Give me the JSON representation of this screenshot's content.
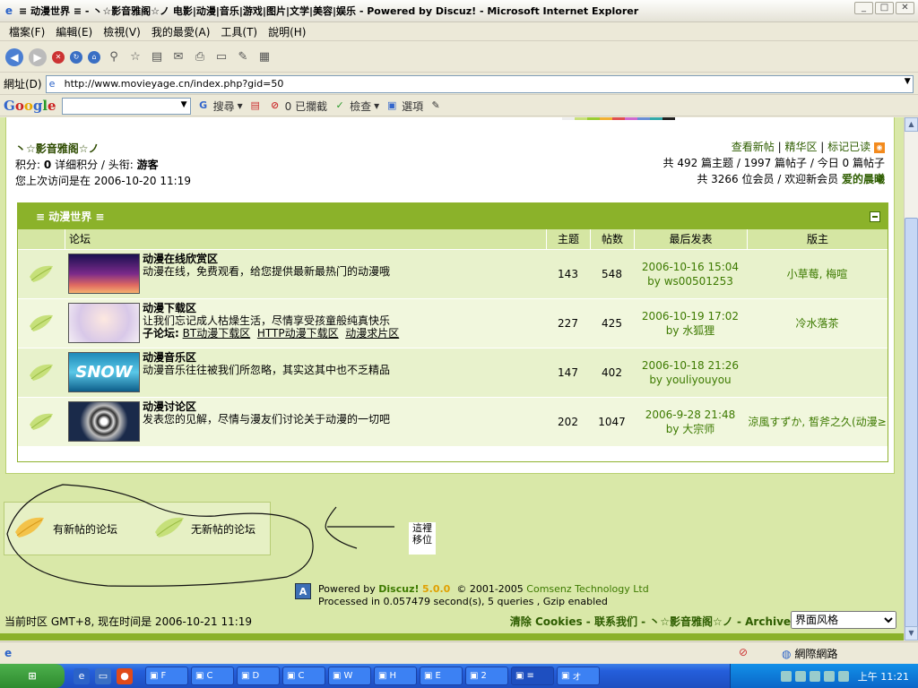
{
  "window": {
    "title": "≡ 动漫世界 ≡ - 丶☆影音雅阁☆ノ 电影|动漫|音乐|游戏|图片|文学|美容|娱乐 - Powered by Discuz! - Microsoft Internet Explorer"
  },
  "menu": [
    "檔案(F)",
    "編輯(E)",
    "檢視(V)",
    "我的最愛(A)",
    "工具(T)",
    "說明(H)"
  ],
  "address": {
    "label": "網址(D)",
    "url": "http://www.movieyage.cn/index.php?gid=50"
  },
  "google": {
    "logo": "Google",
    "search_label": "搜尋",
    "blocked_label": "0 已攔截",
    "check_label": "檢查",
    "options_label": "選項"
  },
  "header": {
    "site_name": "丶☆影音雅阁☆ノ",
    "points_label": "积分:",
    "points_value": "0",
    "points_detail": "详细积分 / 头衔:",
    "rank": "游客",
    "last_visit": "您上次访问是在 2006-10-20 11:19",
    "links": [
      "查看新帖",
      "精华区",
      "标记已读"
    ],
    "stats": "共 492 篇主题 / 1997 篇帖子 / 今日 0 篇帖子",
    "members_prefix": "共 3266 位会员 / 欢迎新会员",
    "newest_member": "爱的晨曦"
  },
  "forum_group": {
    "title": "≡ 动漫世界 ≡",
    "columns": {
      "forum": "论坛",
      "topics": "主题",
      "posts": "帖数",
      "last_post": "最后发表",
      "moderators": "版主"
    },
    "forums": [
      {
        "name": "动漫在线欣赏区",
        "desc": "动漫在线，免费观看，给您提供最新最热门的动漫哦",
        "sub_label": "",
        "subforums": [],
        "topics": "143",
        "posts": "548",
        "last_date": "2006-10-16 15:04",
        "last_by": "by ws00501253",
        "moderators": "小草莓, 梅喧"
      },
      {
        "name": "动漫下载区",
        "desc": "让我们忘记成人枯燥生活，尽情享受孩童般纯真快乐",
        "sub_label": "子论坛:",
        "subforums": [
          "BT动漫下载区",
          "HTTP动漫下载区",
          "动漫求片区"
        ],
        "topics": "227",
        "posts": "425",
        "last_date": "2006-10-19 17:02",
        "last_by": "by 水狐狸",
        "moderators": "冷水落茶"
      },
      {
        "name": "动漫音乐区",
        "desc": "动漫音乐往往被我们所忽略，其实这其中也不乏精品",
        "sub_label": "",
        "subforums": [],
        "topics": "147",
        "posts": "402",
        "last_date": "2006-10-18 21:26",
        "last_by": "by youliyouyou",
        "moderators": ""
      },
      {
        "name": "动漫讨论区",
        "desc": "发表您的见解，尽情与漫友们讨论关于动漫的一切吧",
        "sub_label": "",
        "subforums": [],
        "topics": "202",
        "posts": "1047",
        "last_date": "2006-9-28 21:48",
        "last_by": "by 大宗师",
        "moderators": "涼風すずか, 皙斧之久(动漫≥"
      }
    ]
  },
  "legend": {
    "new_posts": "有新帖的论坛",
    "no_new_posts": "无新帖的论坛"
  },
  "annotation": "這裡移位",
  "footer": {
    "powered_prefix": "Powered by",
    "product": "Discuz!",
    "version": "5.0.0",
    "copyright_years": "© 2001-2005",
    "company": "Comsenz Technology Ltd",
    "processed": "Processed in 0.057479 second(s), 5 queries , Gzip enabled"
  },
  "bottom": {
    "timezone": "当前时区 GMT+8, 现在时间是 2006-10-21 11:19",
    "links": "清除 Cookies - 联系我们 - 丶☆影音雅阁☆ノ - Archiver",
    "style_select": "界面风格"
  },
  "status": {
    "zone": "網際網路"
  },
  "taskbar": {
    "tasks": [
      "F",
      "C",
      "D",
      "C",
      "W",
      "H",
      "E",
      "2",
      "≡",
      "オ"
    ],
    "clock": "上午 11:21"
  },
  "colors": {
    "forum_header": "#8bb22a",
    "page_bg": "#d9e8a8",
    "link_green": "#3d7a00"
  }
}
